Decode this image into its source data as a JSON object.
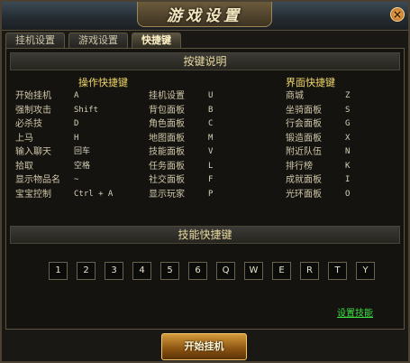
{
  "window": {
    "title": "游戏设置",
    "close_label": "×"
  },
  "tabs": [
    {
      "label": "挂机设置",
      "active": false
    },
    {
      "label": "游戏设置",
      "active": false
    },
    {
      "label": "快捷键",
      "active": true
    }
  ],
  "shortcuts": {
    "header": "按键说明",
    "operation_title": "操作快捷键",
    "interface_title": "界面快捷键",
    "col1": [
      {
        "name": "开始挂机",
        "key": "A"
      },
      {
        "name": "强制攻击",
        "key": "Shift"
      },
      {
        "name": "必杀技",
        "key": "D"
      },
      {
        "name": "上马",
        "key": "H"
      },
      {
        "name": "输入聊天",
        "key": "回车"
      },
      {
        "name": "拾取",
        "key": "空格"
      },
      {
        "name": "显示物品名",
        "key": "~"
      },
      {
        "name": "宝宝控制",
        "key": "Ctrl + A"
      }
    ],
    "col2": [
      {
        "name": "挂机设置",
        "key": "U"
      },
      {
        "name": "背包面板",
        "key": "B"
      },
      {
        "name": "角色面板",
        "key": "C"
      },
      {
        "name": "地图面板",
        "key": "M"
      },
      {
        "name": "技能面板",
        "key": "V"
      },
      {
        "name": "任务面板",
        "key": "L"
      },
      {
        "name": "社交面板",
        "key": "F"
      },
      {
        "name": "显示玩家",
        "key": "P"
      }
    ],
    "col3": [
      {
        "name": "商城",
        "key": "Z"
      },
      {
        "name": "坐骑面板",
        "key": "S"
      },
      {
        "name": "行会面板",
        "key": "G"
      },
      {
        "name": "锻造面板",
        "key": "X"
      },
      {
        "name": "附近队伍",
        "key": "N"
      },
      {
        "name": "排行榜",
        "key": "K"
      },
      {
        "name": "成就面板",
        "key": "I"
      },
      {
        "name": "光环面板",
        "key": "O"
      }
    ]
  },
  "skills": {
    "header": "技能快捷键",
    "keys": [
      "1",
      "2",
      "3",
      "4",
      "5",
      "6",
      "Q",
      "W",
      "E",
      "R",
      "T",
      "Y"
    ],
    "set_link": "设置技能"
  },
  "start_button": "开始挂机"
}
